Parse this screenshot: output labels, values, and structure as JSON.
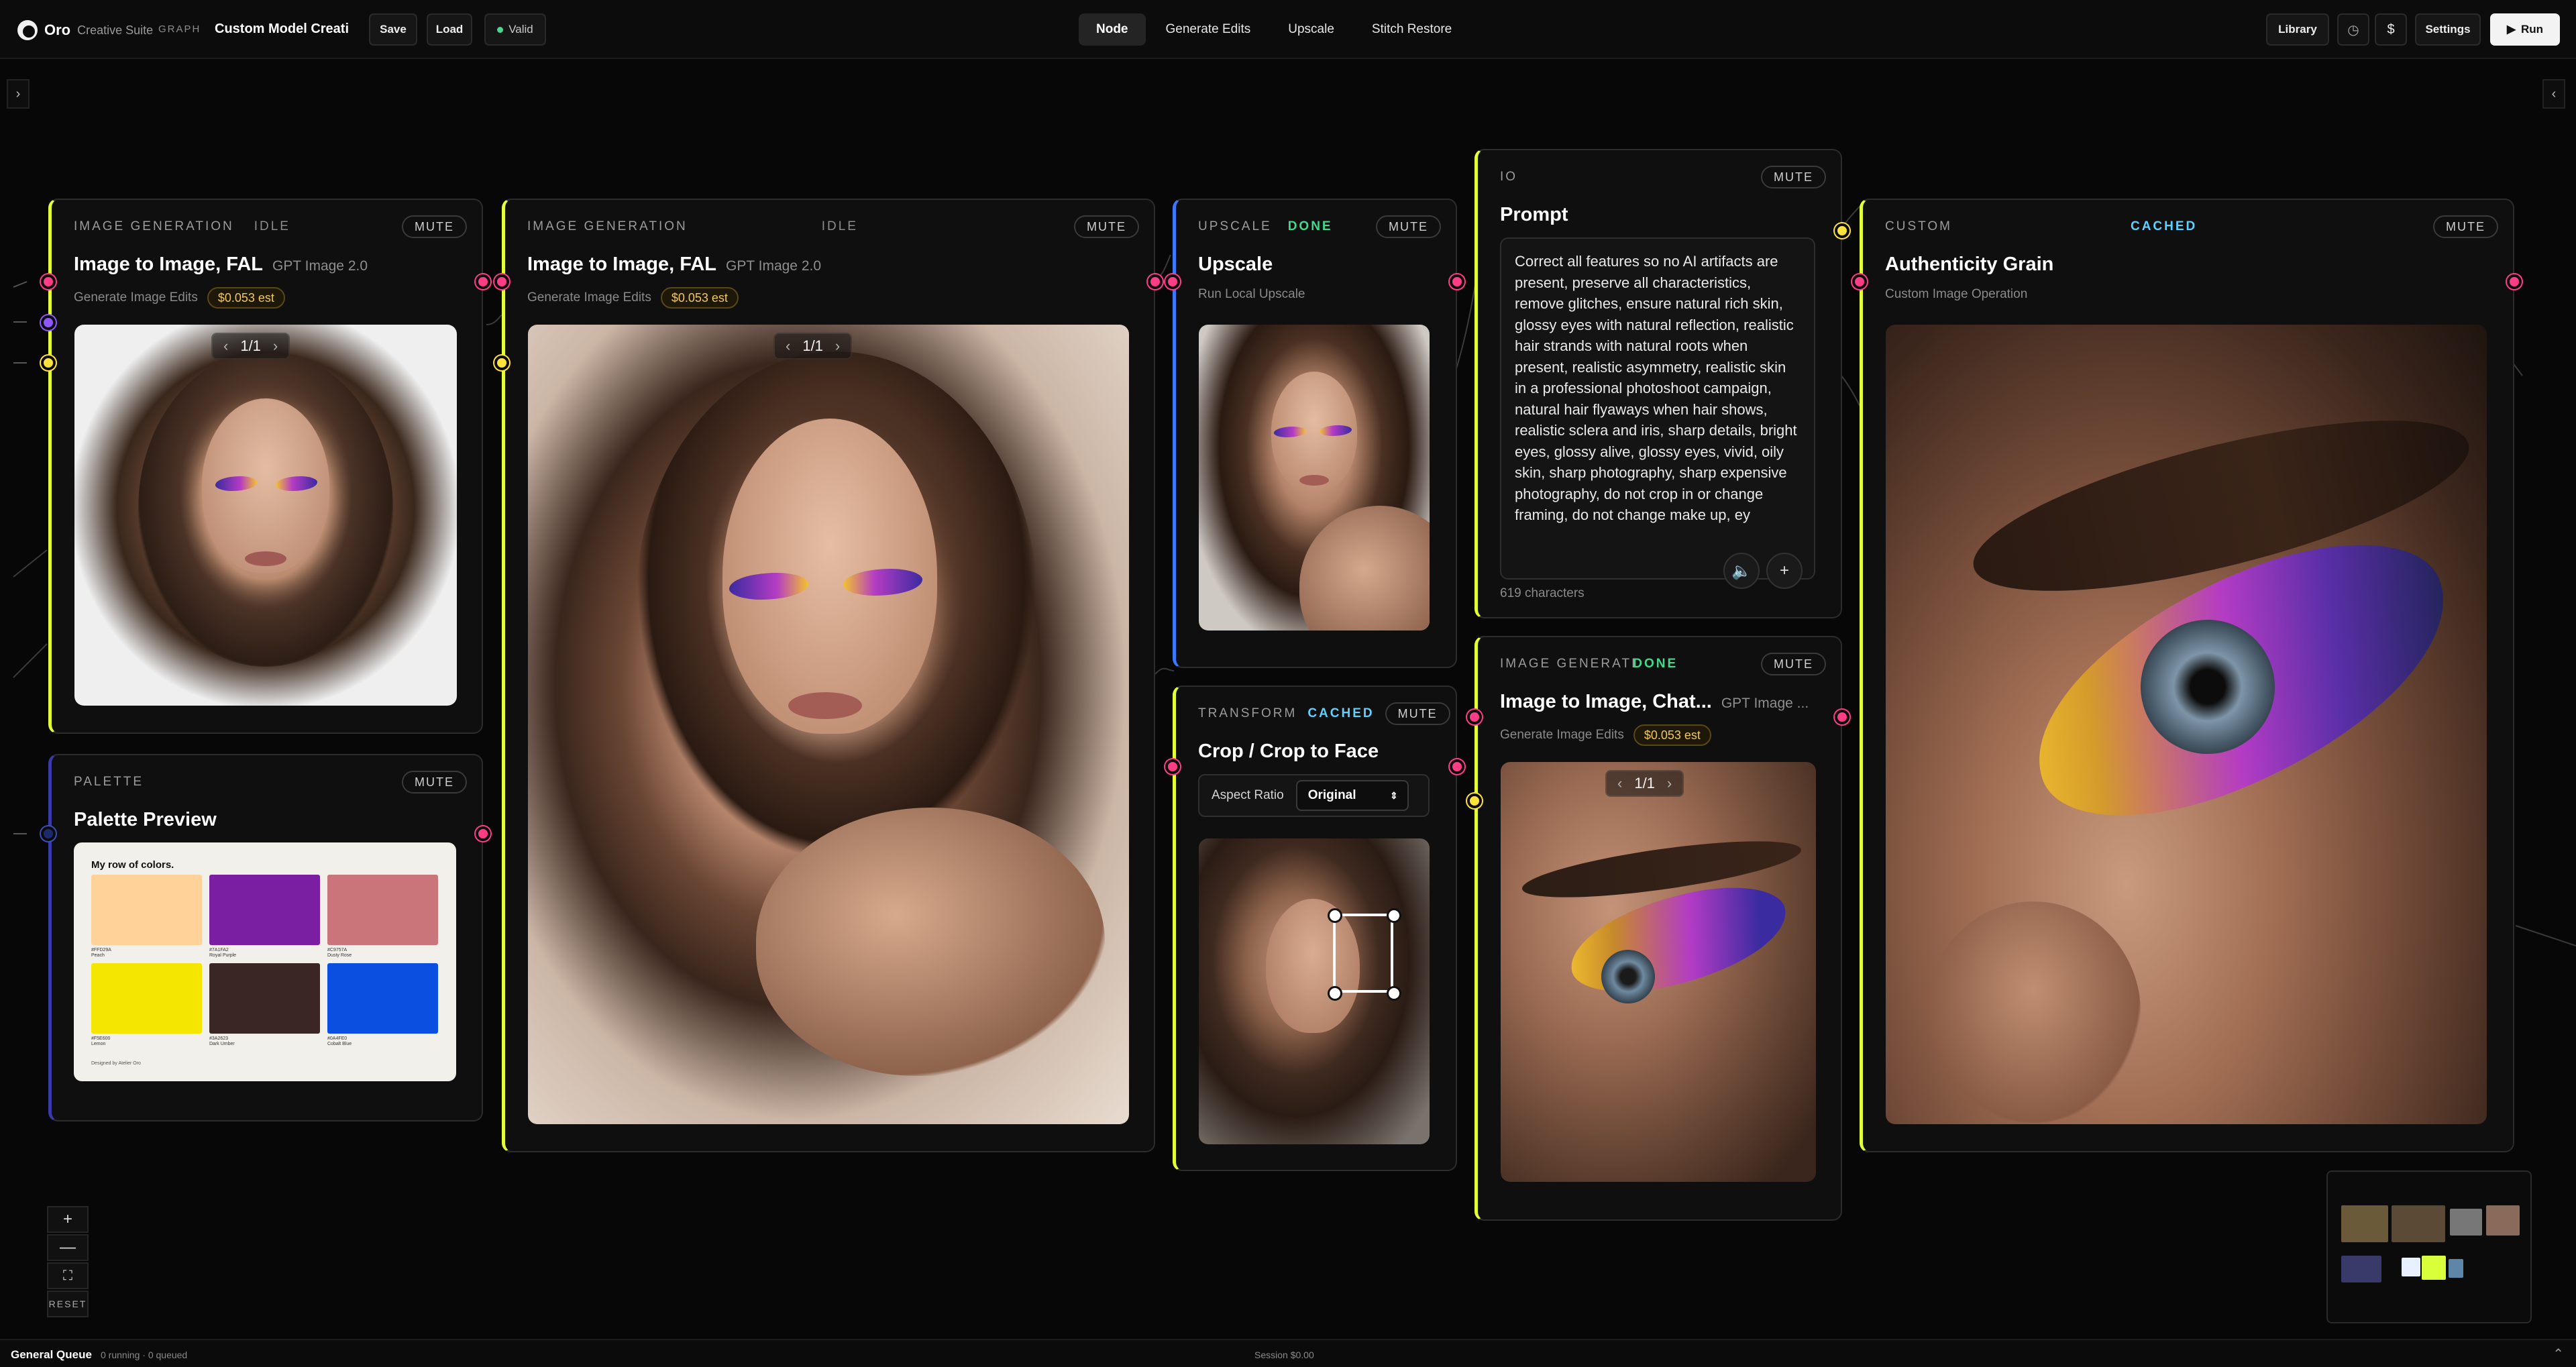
{
  "topbar": {
    "brand": "Oro",
    "brand_sub": "Creative Suite",
    "graph_tag": "GRAPH",
    "doc_title": "Custom Model Creati",
    "save": "Save",
    "load": "Load",
    "valid": "Valid",
    "tabs": [
      {
        "label": "Node"
      },
      {
        "label": "Generate Edits"
      },
      {
        "label": "Upscale"
      },
      {
        "label": "Stitch Restore"
      }
    ],
    "library": "Library",
    "dollar": "$",
    "settings": "Settings",
    "run": "Run"
  },
  "nodes": {
    "gen1": {
      "category": "IMAGE GENERATION",
      "status": "IDLE",
      "mute": "MUTE",
      "title": "Image to Image, FAL",
      "model": "GPT Image 2.0",
      "sub": "Generate Image Edits",
      "cost": "$0.053 est",
      "pager": "1/1"
    },
    "gen2": {
      "category": "IMAGE GENERATION",
      "status": "IDLE",
      "mute": "MUTE",
      "title": "Image to Image, FAL",
      "model": "GPT Image 2.0",
      "sub": "Generate Image Edits",
      "cost": "$0.053 est",
      "pager": "1/1"
    },
    "upscale": {
      "category": "UPSCALE",
      "status": "DONE",
      "mute": "MUTE",
      "title": "Upscale",
      "sub": "Run Local Upscale"
    },
    "crop": {
      "category": "TRANSFORM",
      "status": "CACHED",
      "mute": "MUTE",
      "title": "Crop / Crop to Face",
      "ar_label": "Aspect Ratio",
      "ar_value": "Original"
    },
    "prompt": {
      "category": "IO",
      "mute": "MUTE",
      "title": "Prompt",
      "text": "Correct all features so no AI artifacts are present, preserve all characteristics, remove glitches, ensure natural rich skin, glossy eyes with natural reflection, realistic hair strands with natural roots when present, realistic asymmetry, realistic skin in a professional photoshoot campaign, natural hair flyaways when hair shows, realistic sclera and iris, sharp details, bright eyes, glossy alive, glossy eyes, vivid, oily skin, sharp photography, sharp expensive photography, do not crop in or change framing, do not change make up, ey",
      "chars": "619 characters"
    },
    "gen3": {
      "category": "IMAGE GENERATI",
      "status": "DONE",
      "mute": "MUTE",
      "title": "Image to Image, Chat...",
      "model": "GPT Image ...",
      "sub": "Generate Image Edits",
      "cost": "$0.053 est",
      "pager": "1/1"
    },
    "custom": {
      "category": "CUSTOM",
      "status": "CACHED",
      "mute": "MUTE",
      "title": "Authenticity Grain",
      "sub": "Custom Image Operation"
    },
    "palette": {
      "category": "PALETTE",
      "mute": "MUTE",
      "title": "Palette Preview",
      "card_title": "My row of colors.",
      "footer": "Designed by Atelier Oro",
      "swatches": [
        {
          "hex": "#FFD29A",
          "name": "Peach"
        },
        {
          "hex": "#7A1FA2",
          "name": "Royal Purple"
        },
        {
          "hex": "#C9757A",
          "name": "Dusty Rose"
        },
        {
          "hex": "#F5E600",
          "name": "Lemon"
        },
        {
          "hex": "#3A2623",
          "name": "Dark Umber"
        },
        {
          "hex": "#0A4FE0",
          "name": "Cobalt Blue"
        }
      ]
    }
  },
  "controls": {
    "zoom_in": "+",
    "zoom_out": "—",
    "fit": "⛶",
    "reset": "RESET"
  },
  "status": {
    "queue": "General Queue",
    "queue_sub": "0 running · 0 queued",
    "session": "Session $0.00"
  },
  "colors": {
    "accent_yellow": "#e4ff3a",
    "accent_blue": "#3a78ff",
    "accent_purple": "#3a3aa8",
    "port_pink": "#ff3d86",
    "port_yellow": "#ffe33a"
  }
}
